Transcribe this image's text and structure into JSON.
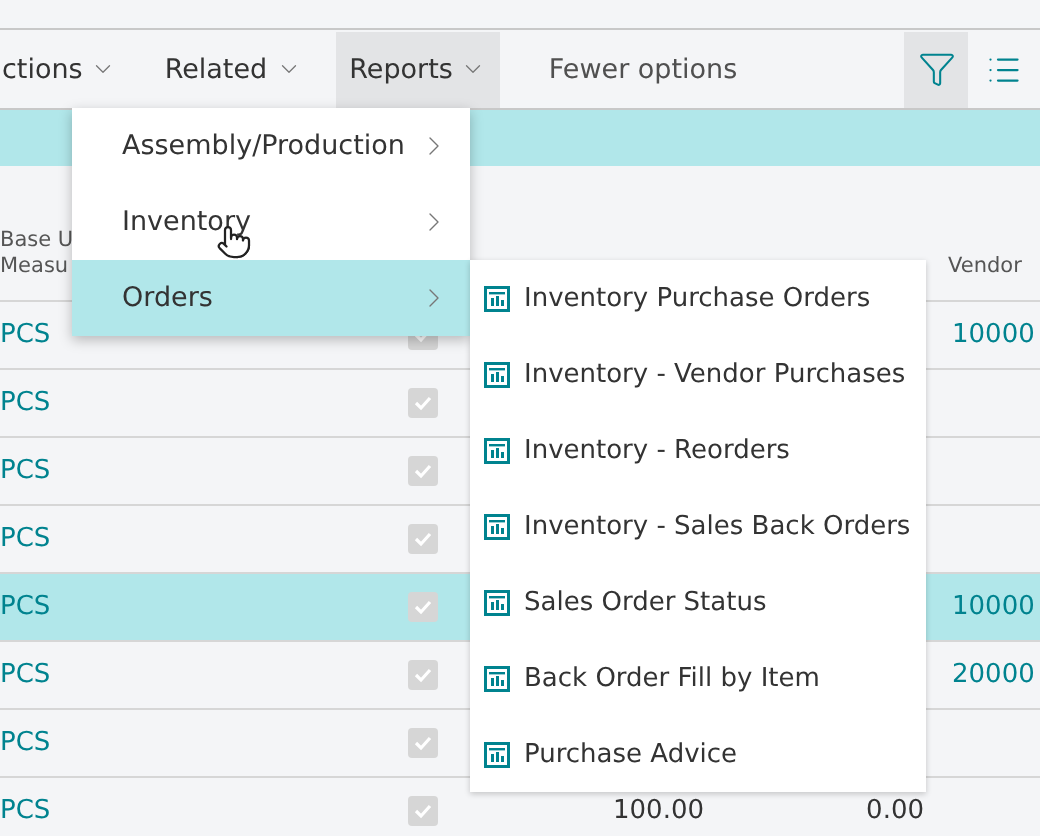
{
  "toolbar": {
    "items": [
      {
        "label": "ctions",
        "selected": false
      },
      {
        "label": "Related",
        "selected": false
      },
      {
        "label": "Reports",
        "selected": true
      }
    ],
    "fewer_options": "Fewer options",
    "filter_selected": true
  },
  "menu": {
    "items": [
      {
        "label": "Assembly/Production",
        "selected": false
      },
      {
        "label": "Inventory",
        "selected": false
      },
      {
        "label": "Orders",
        "selected": true
      }
    ]
  },
  "submenu": {
    "items": [
      "Inventory Purchase Orders",
      "Inventory - Vendor Purchases",
      "Inventory - Reorders",
      "Inventory - Sales Back Orders",
      "Sales Order Status",
      "Back Order Fill by Item",
      "Purchase Advice"
    ]
  },
  "table": {
    "columns": [
      {
        "lines": [
          "Base U",
          "Measu"
        ]
      },
      {
        "lines": [
          "Vendor"
        ]
      }
    ],
    "rows": [
      {
        "unit": "PCS",
        "checked": true,
        "vendor": "10000",
        "selected": false
      },
      {
        "unit": "PCS",
        "checked": true,
        "selected": false
      },
      {
        "unit": "PCS",
        "checked": true,
        "selected": false
      },
      {
        "unit": "PCS",
        "checked": true,
        "selected": false
      },
      {
        "unit": "PCS",
        "checked": true,
        "vendor": "10000",
        "selected": true
      },
      {
        "unit": "PCS",
        "checked": true,
        "vendor": "20000",
        "selected": false
      },
      {
        "unit": "PCS",
        "checked": true,
        "selected": false
      },
      {
        "unit": "PCS",
        "checked": true,
        "column_3": "100.00",
        "column_4": "0.00",
        "selected": false
      }
    ]
  }
}
